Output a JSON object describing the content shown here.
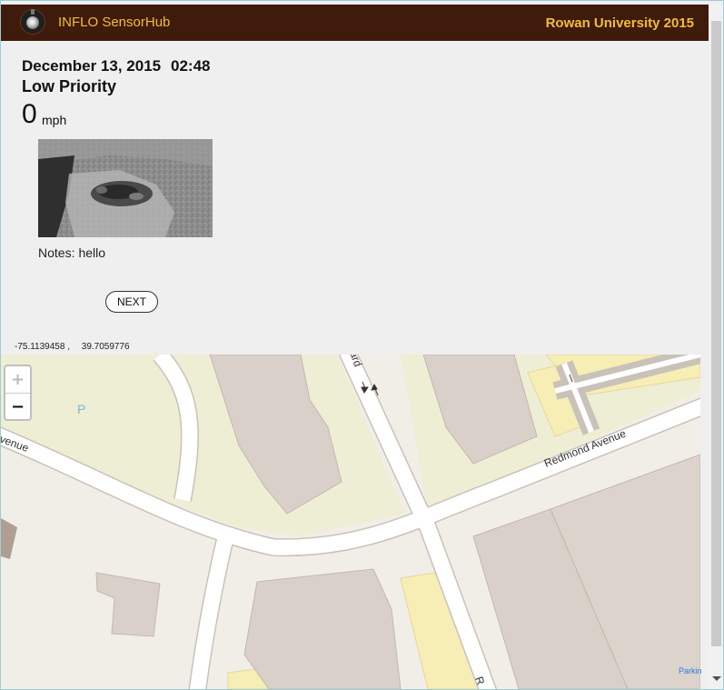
{
  "header": {
    "app_title": "INFLO SensorHub",
    "org_title": "Rowan University 2015",
    "accent_color": "#f3bc3a",
    "bar_color": "#3f1b0b"
  },
  "report": {
    "date": "December 13, 2015",
    "time": "02:48",
    "priority": "Low Priority",
    "speed_value": "0",
    "speed_unit": "mph",
    "notes_label": "Notes:",
    "notes_text": "hello",
    "next_label": "NEXT"
  },
  "location": {
    "longitude": "-75.1139458",
    "separator": ",",
    "latitude": "39.7059776"
  },
  "map": {
    "zoom_in": "+",
    "zoom_out": "−",
    "labels": {
      "p": "P",
      "redmond": "Redmond Avenue",
      "avenue_left": "venue",
      "street_top": "ard",
      "street_bottom": "R"
    },
    "attribution": "Parkin"
  }
}
